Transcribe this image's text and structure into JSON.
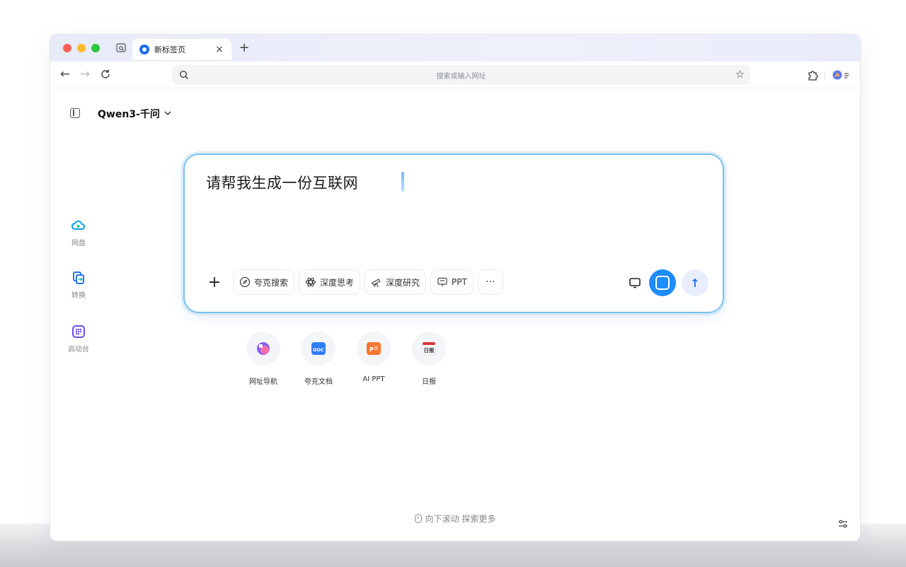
{
  "browser": {
    "tab": {
      "title": "新标签页",
      "close": "×",
      "favicon": "quark-logo-icon"
    },
    "new_tab": "+",
    "nav": {
      "back": "←",
      "forward": "→",
      "reload": "C"
    },
    "address_bar": {
      "placeholder": "搜索或输入网址",
      "icon": "search-icon",
      "bookmark": "☆"
    },
    "extensions_icon": "puzzle-icon",
    "profile_icon": "avatar-menu-icon"
  },
  "header": {
    "sidebar_toggle_icon": "sidebar-icon",
    "model_name": "Qwen3-千问",
    "model_chevron": "⌄"
  },
  "left_nav": [
    {
      "label": "网盘",
      "icon": "cloud-drive-icon"
    },
    {
      "label": "转换",
      "icon": "convert-icon"
    },
    {
      "label": "启动台",
      "icon": "launchpad-icon"
    }
  ],
  "chat": {
    "input_text": "请帮我生成一份互联网",
    "attach": "+",
    "tools": [
      {
        "label": "夸克搜索",
        "icon": "compass-search-icon"
      },
      {
        "label": "深度思考",
        "icon": "atom-think-icon"
      },
      {
        "label": "深度研究",
        "icon": "telescope-icon"
      },
      {
        "label": "PPT",
        "icon": "presentation-icon"
      }
    ],
    "more": "···",
    "send": "↑"
  },
  "quick_links": [
    {
      "label": "网址导航",
      "icon": "nav-icon",
      "color": "#8b5cf6"
    },
    {
      "label": "夸克文档",
      "icon": "doc-icon",
      "badge": "DOC",
      "color": "#2f7ef6"
    },
    {
      "label": "AI PPT",
      "icon": "ppt-icon",
      "badge": "P",
      "color": "#f7772e"
    },
    {
      "label": "日报",
      "icon": "daily-report-icon",
      "badge": "日报",
      "color": "#d93838"
    }
  ],
  "footer": {
    "scroll_hint": "向下滚动 探索更多",
    "settings_icon": "sliders-icon"
  },
  "colors": {
    "accent": "#1d8cff",
    "input_border": "#7cc0ef"
  }
}
